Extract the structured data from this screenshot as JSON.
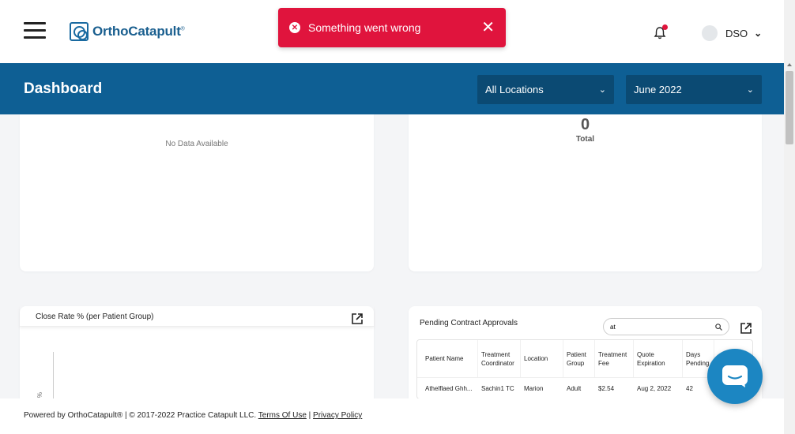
{
  "brand": {
    "name": "OrthoCatapult",
    "mark": "®"
  },
  "toast": {
    "message": "Something went wrong"
  },
  "user": {
    "name": "DSO"
  },
  "header": {
    "title": "Dashboard",
    "location_filter": "All Locations",
    "month_filter": "June 2022"
  },
  "cards": {
    "top_left": {
      "empty_text": "No Data Available"
    },
    "top_right": {
      "total_value": "0",
      "total_label": "Total"
    },
    "close_rate": {
      "title": "Close Rate % (per Patient Group)",
      "axis_tick": "%"
    },
    "pending": {
      "title": "Pending Contract Approvals",
      "search_value": "at",
      "columns": [
        "Patient Name",
        "Treatment Coordinator",
        "Location",
        "Patient Group",
        "Treatment Fee",
        "Quote Expiration",
        "Days Pending"
      ],
      "rows": [
        [
          "Athelflaed Ghh...",
          "Sachin1 TC",
          "Marion",
          "Adult",
          "$2.54",
          "Aug 2, 2022",
          "42"
        ]
      ]
    }
  },
  "footer": {
    "text": "Powered by OrthoCatapult® | © 2017-2022 Practice Catapult LLC. ",
    "terms": "Terms Of Use",
    "separator": " | ",
    "privacy": "Privacy Policy"
  },
  "colors": {
    "primary": "#0e5f94",
    "error": "#e0143d",
    "chat": "#1c86c2"
  },
  "icons": {
    "menu": "hamburger-icon",
    "bell": "bell-icon",
    "external": "external-link-icon",
    "search": "search-icon",
    "chat": "chat-icon"
  }
}
